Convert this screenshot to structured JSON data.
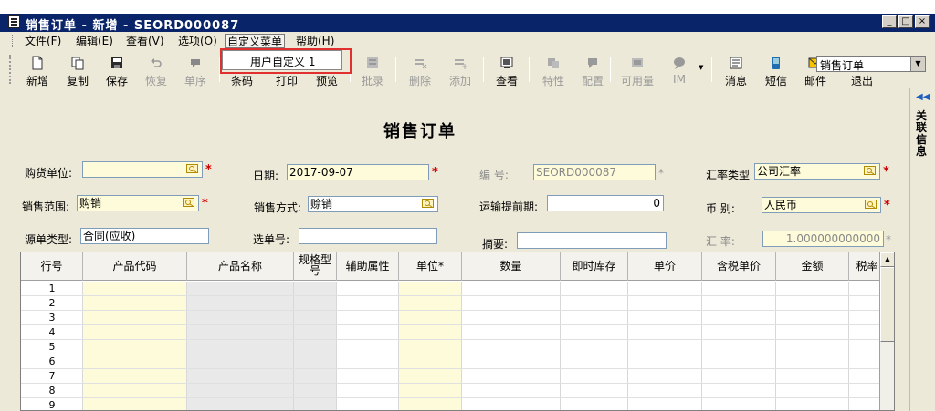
{
  "window": {
    "title": "销售订单 - 新增 - SEORD000087",
    "controls": [
      "_",
      "□",
      "×"
    ]
  },
  "menu": [
    {
      "label": "文件(F)"
    },
    {
      "label": "编辑(E)"
    },
    {
      "label": "查看(V)"
    },
    {
      "label": "选项(O)"
    },
    {
      "label": "自定义菜单"
    },
    {
      "label": "帮助(H)"
    }
  ],
  "dropdown": {
    "item": "用户自定义 1"
  },
  "toolbar": [
    {
      "label": "新增",
      "icon": "new-doc-icon",
      "enabled": true
    },
    {
      "label": "复制",
      "icon": "copy-icon",
      "enabled": true
    },
    {
      "label": "保存",
      "icon": "save-icon",
      "enabled": true
    },
    {
      "label": "恢复",
      "icon": "undo-icon",
      "enabled": false
    },
    {
      "label": "单序",
      "icon": "sort-icon",
      "enabled": false
    },
    {
      "label": "条码",
      "icon": "barcode-icon",
      "enabled": true
    },
    {
      "label": "打印",
      "icon": "print-icon",
      "enabled": true
    },
    {
      "label": "预览",
      "icon": "preview-icon",
      "enabled": true
    },
    {
      "label": "批录",
      "icon": "batch-icon",
      "enabled": false
    },
    {
      "label": "删除",
      "icon": "delete-row-icon",
      "enabled": false
    },
    {
      "label": "添加",
      "icon": "add-row-icon",
      "enabled": false
    },
    {
      "label": "查看",
      "icon": "view-icon",
      "enabled": true
    },
    {
      "label": "特性",
      "icon": "feature-icon",
      "enabled": false
    },
    {
      "label": "配置",
      "icon": "config-icon",
      "enabled": false
    },
    {
      "label": "可用量",
      "icon": "available-icon",
      "enabled": false
    },
    {
      "label": "IM",
      "icon": "chat-icon",
      "enabled": false
    },
    {
      "label": "消息",
      "icon": "message-icon",
      "enabled": true
    },
    {
      "label": "短信",
      "icon": "sms-icon",
      "enabled": true
    },
    {
      "label": "邮件",
      "icon": "mail-icon",
      "enabled": true
    },
    {
      "label": "退出",
      "icon": "exit-icon",
      "enabled": true
    }
  ],
  "toolbar_combo": {
    "value": "销售订单"
  },
  "form": {
    "title": "销售订单",
    "buyer_label": "购货单位:",
    "buyer_value": "",
    "date_label": "日期:",
    "date_value": "2017-09-07",
    "code_label": "编    号:",
    "code_value": "SEORD000087",
    "rate_type_label": "汇率类型",
    "rate_type_value": "公司汇率",
    "sales_scope_label": "销售范围:",
    "sales_scope_value": "购销",
    "sales_method_label": "销售方式:",
    "sales_method_value": "赊销",
    "transport_label": "运输提前期:",
    "transport_value": "0",
    "currency_label": "币    别:",
    "currency_value": "人民币",
    "source_type_label": "源单类型:",
    "source_type_value": "合同(应收)",
    "select_no_label": "选单号:",
    "select_no_value": "",
    "summary_label": "摘要:",
    "summary_value": "",
    "rate_label": "汇    率:",
    "rate_value": "1.000000000000",
    "required_mark": "*"
  },
  "grid": {
    "columns": [
      "行号",
      "产品代码",
      "产品名称",
      "规格型号",
      "辅助属性",
      "单位*",
      "数量",
      "即时库存",
      "单价",
      "含税单价",
      "金额",
      "税率"
    ],
    "rows": [
      "1",
      "2",
      "3",
      "4",
      "5",
      "6",
      "7",
      "8",
      "9"
    ]
  },
  "sidepanel": {
    "label": "关联信息",
    "toggle": "◀◀"
  },
  "colors": {
    "titlebar": "#0a246a",
    "required": "#d00000",
    "field_yellow": "#fdfbd9",
    "highlight": "#e03030"
  }
}
